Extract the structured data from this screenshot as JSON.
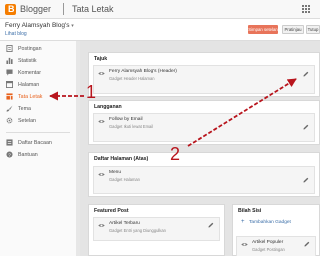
{
  "app": {
    "name": "Blogger",
    "page_title": "Tata Letak"
  },
  "blog": {
    "name": "Ferry Alamsyah Blog's",
    "url": "Lihat blog"
  },
  "actions": {
    "save": "Simpan setelan",
    "preview": "Pratinjau",
    "clear": "Tutup"
  },
  "sidebar": {
    "items": [
      {
        "label": "Postingan",
        "icon": "postingan-icon"
      },
      {
        "label": "Statistik",
        "icon": "bar-chart-icon"
      },
      {
        "label": "Komentar",
        "icon": "comment-icon"
      },
      {
        "label": "Halaman",
        "icon": "page-icon"
      },
      {
        "label": "Tata Letak",
        "icon": "layout-icon",
        "active": true
      },
      {
        "label": "Tema",
        "icon": "brush-icon"
      },
      {
        "label": "Setelan",
        "icon": "gear-icon"
      },
      {
        "label": "Daftar Bacaan",
        "icon": "list-icon"
      },
      {
        "label": "Bantuan",
        "icon": "help-icon"
      }
    ]
  },
  "sections": {
    "tajuk": {
      "title": "Tajuk",
      "gadget": {
        "name": "Ferry Alamsyah Blog's (Header)",
        "type": "Gadget Header Halaman"
      }
    },
    "langganan": {
      "title": "Langganan",
      "gadget": {
        "name": "Follow by Email",
        "type": "Gadget Ikuti lewat Email"
      }
    },
    "daftar": {
      "title": "Daftar Halaman (Atas)",
      "gadget": {
        "name": "Menu",
        "type": "Gadget Halaman"
      }
    },
    "featured": {
      "title": "Featured Post",
      "gadget": {
        "name": "Artikel Terbaru",
        "type": "Gadget Entri yang Diunggulkan"
      }
    },
    "bilah": {
      "title": "Bilah Sisi",
      "add": "Tambahkan Gadget",
      "gadget": {
        "name": "Artikel Populer",
        "type": "Gadget Postingan"
      }
    }
  },
  "annotations": {
    "one": "1",
    "two": "2"
  },
  "colors": {
    "accent": "#e8611c",
    "annotation": "#b8151d"
  }
}
